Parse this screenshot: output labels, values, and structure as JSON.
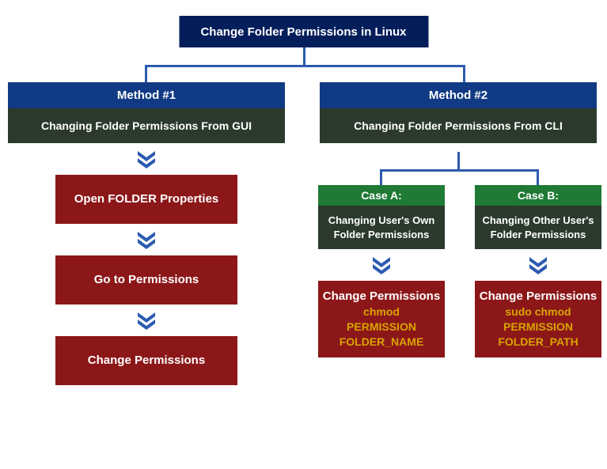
{
  "title": "Change Folder Permissions in Linux",
  "colors": {
    "navy": "#041e5b",
    "blue": "#113a84",
    "darkolive": "#2b3a2d",
    "maroon": "#8c1718",
    "green": "#1e7a34",
    "arrow": "#2b5baf",
    "amber": "#d9a400"
  },
  "method1": {
    "header": "Method #1",
    "subtitle": "Changing Folder Permissions From GUI",
    "steps": [
      "Open FOLDER Properties",
      "Go to Permissions",
      "Change Permissions"
    ]
  },
  "method2": {
    "header": "Method #2",
    "subtitle": "Changing Folder Permissions From CLI",
    "caseA": {
      "header": "Case A:",
      "subtitle": "Changing User's Own Folder Permissions",
      "step_label": "Change Permissions",
      "cmd1": "chmod",
      "cmd2": "PERMISSION",
      "cmd3": "FOLDER_NAME"
    },
    "caseB": {
      "header": "Case B:",
      "subtitle": "Changing Other User's Folder Permissions",
      "step_label": "Change Permissions",
      "cmd1": "sudo chmod",
      "cmd2": "PERMISSION",
      "cmd3": "FOLDER_PATH"
    }
  }
}
